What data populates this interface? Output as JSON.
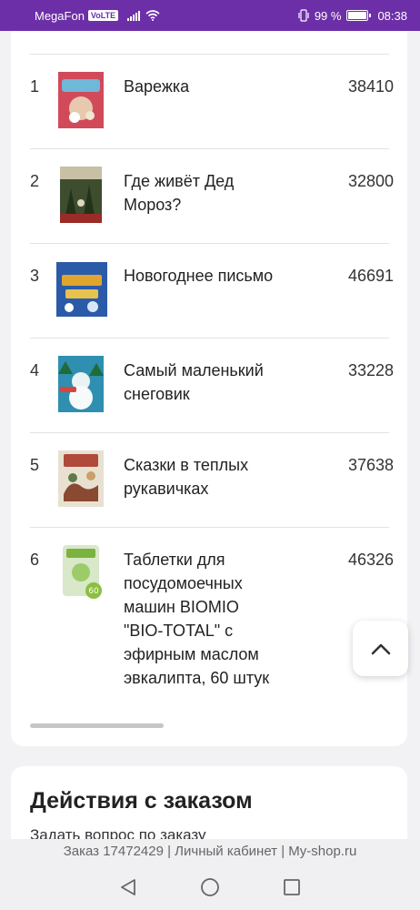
{
  "status_bar": {
    "carrier": "MegaFon",
    "volte": "VoLTE",
    "battery": "99 %",
    "time": "08:38",
    "battery_level": 0.99
  },
  "products": [
    {
      "index": "1",
      "name": "Варежка",
      "code": "38410",
      "thumb_colors": [
        "#d14a5a",
        "#e8c9b0"
      ]
    },
    {
      "index": "2",
      "name": "Где живёт Дед Мороз?",
      "code": "32800",
      "thumb_colors": [
        "#3d4d2e",
        "#c8c0a5"
      ]
    },
    {
      "index": "3",
      "name": "Новогоднее письмо",
      "code": "46691",
      "thumb_colors": [
        "#2b5aa8",
        "#e0a52e"
      ]
    },
    {
      "index": "4",
      "name": "Самый маленький снеговик",
      "code": "33228",
      "thumb_colors": [
        "#2e8fb0",
        "#eaf2f4"
      ]
    },
    {
      "index": "5",
      "name": "Сказки в теплых рукавичках",
      "code": "37638",
      "thumb_colors": [
        "#b04a3a",
        "#e9e1d0"
      ]
    },
    {
      "index": "6",
      "name": "Таблетки для посудомоечных машин BIOMIO \"BIO-TOTAL\" с эфирным маслом эвкалипта, 60 штук",
      "code": "46326",
      "thumb_colors": [
        "#7ab33f",
        "#d8e8c8"
      ]
    }
  ],
  "actions": {
    "title": "Действия с заказом",
    "ask_question": "Задать вопрос по заказу"
  },
  "footer": {
    "text": "Заказ 17472429 | Личный кабинет | My-shop.ru"
  },
  "icons": {
    "back_to_top": "chevron-up-icon",
    "nav_back": "triangle-back-icon",
    "nav_home": "circle-home-icon",
    "nav_recent": "square-recent-icon"
  },
  "colors": {
    "status_bar": "#6d2fa8",
    "background": "#f2f2f5"
  }
}
